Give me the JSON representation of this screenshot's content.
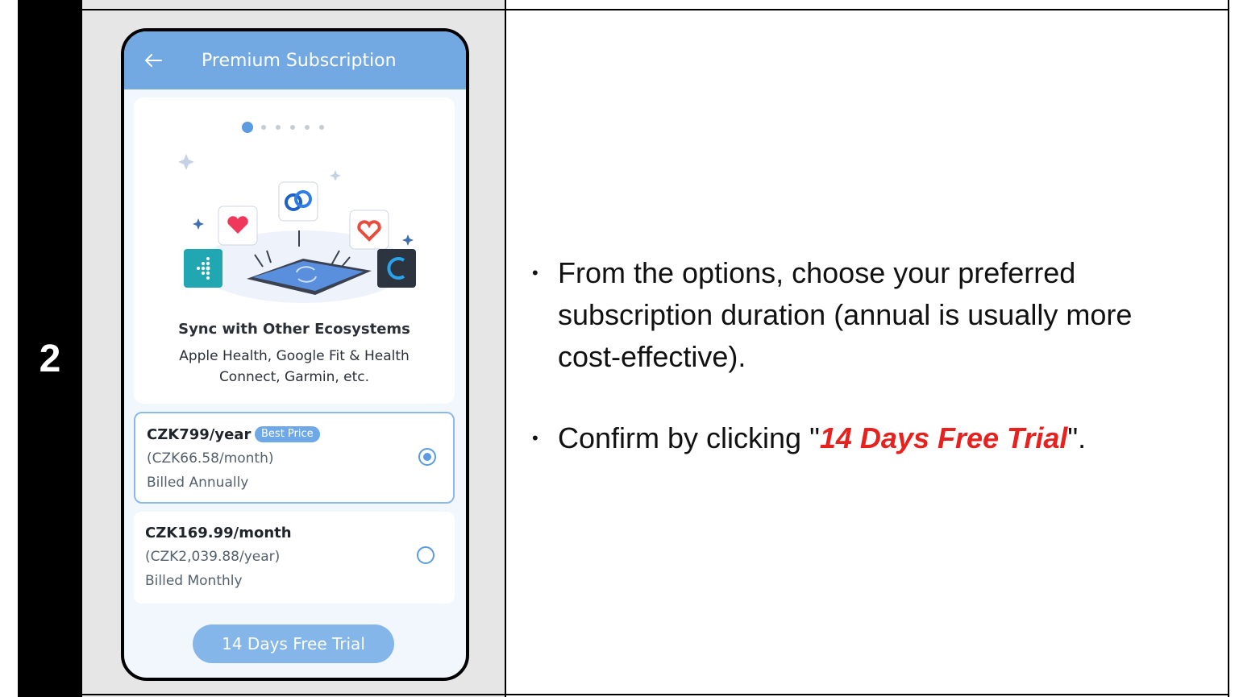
{
  "step": {
    "number": "2"
  },
  "phone": {
    "appbar": {
      "title": "Premium Subscription",
      "back_icon": "arrow-left-icon"
    },
    "carousel": {
      "total_dots": 6,
      "active_index": 0
    },
    "feature": {
      "title": "Sync with Other Ecosystems",
      "description": "Apple Health, Google Fit & Health Connect, Garmin, etc."
    },
    "plans": [
      {
        "price": "CZK799/year",
        "badge": "Best Price",
        "sub": "(CZK66.58/month)",
        "billed": "Billed Annually",
        "selected": true
      },
      {
        "price": "CZK169.99/month",
        "badge": "",
        "sub": "(CZK2,039.88/year)",
        "billed": "Billed Monthly",
        "selected": false
      }
    ],
    "cta": {
      "label": "14 Days Free Trial"
    }
  },
  "instructions": {
    "bullet1": "From the options, choose your preferred subscription duration (annual is usually more cost-effective).",
    "bullet2_prefix": "Confirm by clicking \"",
    "bullet2_highlight": "14 Days Free Trial",
    "bullet2_suffix": "\"."
  },
  "colors": {
    "appbar": "#72a9e3",
    "accent": "#5b9be0",
    "highlight": "#e8211f"
  }
}
